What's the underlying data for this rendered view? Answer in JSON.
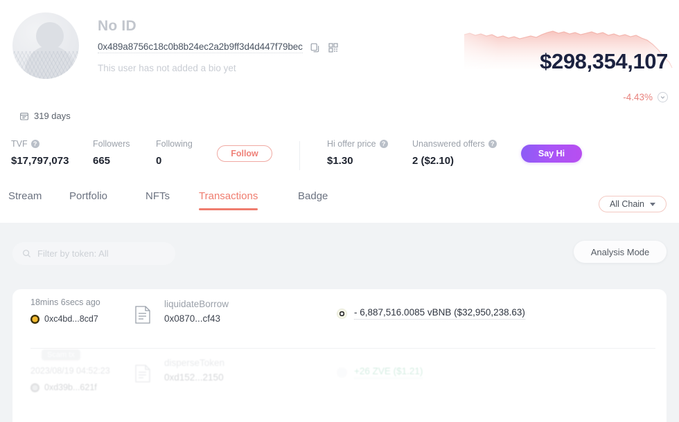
{
  "profile": {
    "name": "No ID",
    "address": "0x489a8756c18c0b8b24ec2a2b9ff3d4d447f79bec",
    "bio": "This user has not added a bio yet",
    "days_badge": "319 days",
    "copy_icon": "copy-icon",
    "qr_icon": "qr-code-icon",
    "avatar_icon": "default-avatar"
  },
  "balance": {
    "amount": "$298,354,107",
    "change": "-4.43%",
    "change_color": "#e8837e",
    "expand_icon": "chevron-down-icon"
  },
  "stats": [
    {
      "label": "TVF",
      "value": "$17,797,073",
      "has_help": true
    },
    {
      "label": "Followers",
      "value": "665",
      "has_help": false
    },
    {
      "label": "Following",
      "value": "0",
      "has_help": false
    },
    {
      "label": "Hi offer price",
      "value": "$1.30",
      "has_help": true
    },
    {
      "label": "Unanswered offers",
      "value": "2 ($2.10)",
      "has_help": true
    }
  ],
  "actions": {
    "follow_label": "Follow",
    "follow_color": "#ef8279",
    "say_hi_label": "Say Hi",
    "say_hi_color": "#a855f7"
  },
  "tabs": [
    {
      "label": "Stream",
      "active": false
    },
    {
      "label": "Portfolio",
      "active": false
    },
    {
      "label": "NFTs",
      "active": false
    },
    {
      "label": "Transactions",
      "active": true
    },
    {
      "label": "Badge",
      "active": false
    }
  ],
  "tab_accent": "#ef7c6e",
  "chain_select": {
    "value": "All Chain",
    "caret_icon": "chevron-down-icon"
  },
  "filter": {
    "placeholder": "Filter by token: All",
    "icon": "search-icon"
  },
  "analysis_button": {
    "label": "Analysis Mode"
  },
  "transactions": [
    {
      "time": "18mins 6secs ago",
      "from_address": "0xc4bd...8cd7",
      "chain_icon": "bnb-chain-icon",
      "method": "liquidateBorrow",
      "hash": "0x0870...cf43",
      "doc_icon": "contract-icon",
      "token_icon": "vbnb-token-icon",
      "amount": "- 6,887,516.0085 vBNB ($32,950,238.63)",
      "direction": "out",
      "scam_badge": null
    },
    {
      "time": "2023/08/19 04:52:23",
      "from_address": "0xd39b...621f",
      "chain_icon": "chain-icon",
      "method": "disperseToken",
      "hash": "0xd152...2150",
      "doc_icon": "contract-icon",
      "token_icon": "zve-token-icon",
      "amount": "+26 ZVE ($1.21)",
      "direction": "in",
      "scam_badge": "Scam tx"
    }
  ]
}
